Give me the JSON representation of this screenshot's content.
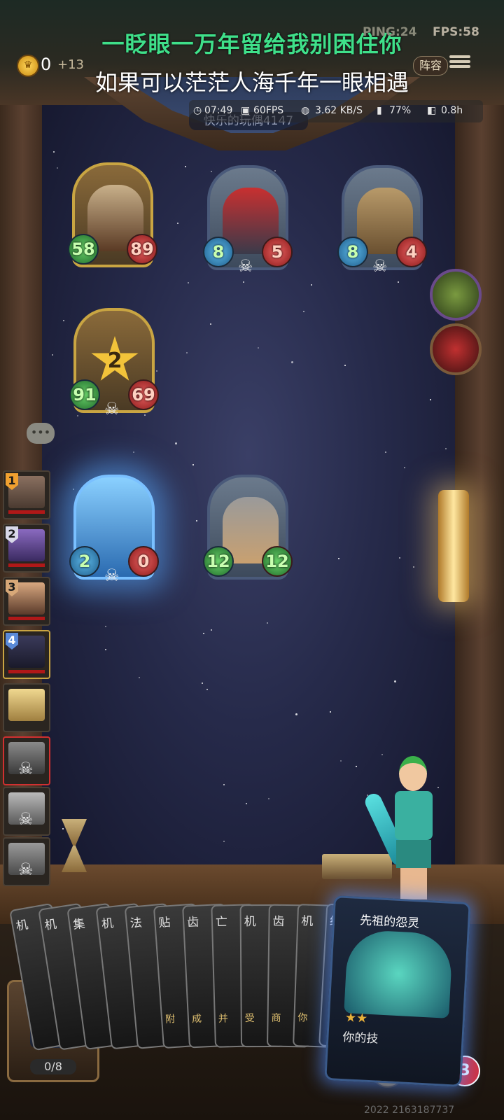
{
  "overlay": {
    "lyric_line1": "一眨眼一万年留给我别困住你",
    "lyric_line2": "如果可以茫茫人海千年一眼相遇",
    "ping": "PING:24",
    "fps": "FPS:58"
  },
  "top": {
    "coins": "0",
    "coin_income": "+13",
    "lineup_label": "阵容",
    "player_name": "快乐的玩偶4147"
  },
  "status": {
    "time": "07:49",
    "framerate": "60FPS",
    "network": "3.62 KB/S",
    "battery": "77%",
    "duration": "0.8h"
  },
  "board": {
    "minions": [
      {
        "atk": "58",
        "hp": "89",
        "gold": true
      },
      {
        "atk": "8",
        "hp": "5"
      },
      {
        "atk": "8",
        "hp": "4"
      },
      {
        "atk": "91",
        "hp": "69",
        "tier": "2",
        "gold": true
      },
      {
        "atk": "2",
        "hp": "0",
        "glow": true
      },
      {
        "atk": "12",
        "hp": "12"
      }
    ]
  },
  "opponents": [
    {
      "rank": "1",
      "rank_color": "#f0a030"
    },
    {
      "rank": "2",
      "rank_color": "#d8d8e8"
    },
    {
      "rank": "3",
      "rank_color": "#d8a878"
    },
    {
      "rank": "4",
      "rank_color": "#5a8ad8"
    },
    {
      "rank": ""
    },
    {
      "rank": "",
      "active": true,
      "dead": true
    },
    {
      "rank": "",
      "dead": true
    },
    {
      "rank": "",
      "dead": true
    }
  ],
  "hand": {
    "cards": [
      {
        "title": "机",
        "desc": ""
      },
      {
        "title": "机",
        "desc": ""
      },
      {
        "title": "集",
        "desc": ""
      },
      {
        "title": "机",
        "desc": ""
      },
      {
        "title": "法",
        "desc": ""
      },
      {
        "title": "贴",
        "desc": "附"
      },
      {
        "title": "齿",
        "desc": "成"
      },
      {
        "title": "亡",
        "desc": "并"
      },
      {
        "title": "机",
        "desc": "受"
      },
      {
        "title": "齿",
        "desc": "商"
      },
      {
        "title": "机",
        "desc": "你"
      },
      {
        "title": "红",
        "desc": ""
      }
    ],
    "featured_title": "先祖的怨灵",
    "featured_stars": "★★",
    "featured_desc": "你的技"
  },
  "bottom": {
    "slot_count": "0/8",
    "lives": "3",
    "watermark": "2022 2163187737"
  }
}
